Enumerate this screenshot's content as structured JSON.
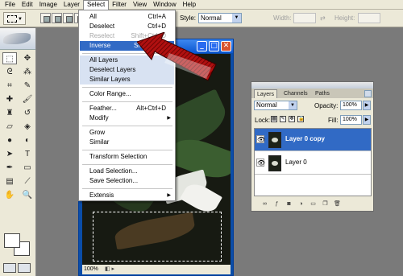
{
  "menubar": {
    "items": [
      "File",
      "Edit",
      "Image",
      "Layer",
      "Select",
      "Filter",
      "View",
      "Window",
      "Help"
    ],
    "active": "Select"
  },
  "options": {
    "style_label": "Style:",
    "style_value": "Normal",
    "width_label": "Width:",
    "height_label": "Height:"
  },
  "select_menu": {
    "items": [
      {
        "label": "All",
        "shortcut": "Ctrl+A"
      },
      {
        "label": "Deselect",
        "shortcut": "Ctrl+D"
      },
      {
        "label": "Reselect",
        "shortcut": "Shift+Ctrl+D",
        "disabled": true
      },
      {
        "label": "Inverse",
        "shortcut": "Shift+Ctrl+I",
        "highlighted": true
      },
      {
        "label": "All Layers"
      },
      {
        "label": "Deselect Layers"
      },
      {
        "label": "Similar Layers"
      },
      {
        "label": "Color Range..."
      },
      {
        "label": "Feather...",
        "shortcut": "Alt+Ctrl+D"
      },
      {
        "label": "Modify",
        "submenu": true
      },
      {
        "label": "Grow"
      },
      {
        "label": "Similar"
      },
      {
        "label": "Transform Selection"
      },
      {
        "label": "Load Selection..."
      },
      {
        "label": "Save Selection..."
      },
      {
        "label": "Extensis",
        "submenu": true
      }
    ]
  },
  "document": {
    "zoom": "100%",
    "minimize": "_",
    "maximize": "□",
    "close": "✕"
  },
  "layers_panel": {
    "tabs": [
      "Layers",
      "Channels",
      "Paths"
    ],
    "blend_mode": "Normal",
    "opacity_label": "Opacity:",
    "opacity": "100%",
    "lock_label": "Lock:",
    "fill_label": "Fill:",
    "fill": "100%",
    "layers": [
      {
        "name": "Layer 0 copy",
        "selected": true
      },
      {
        "name": "Layer 0",
        "selected": false
      }
    ]
  },
  "colors": {
    "highlight": "#316ac5",
    "menu_band": "#d8e2f2",
    "window_title": "#0a55d0",
    "annotation": "#c01414"
  }
}
